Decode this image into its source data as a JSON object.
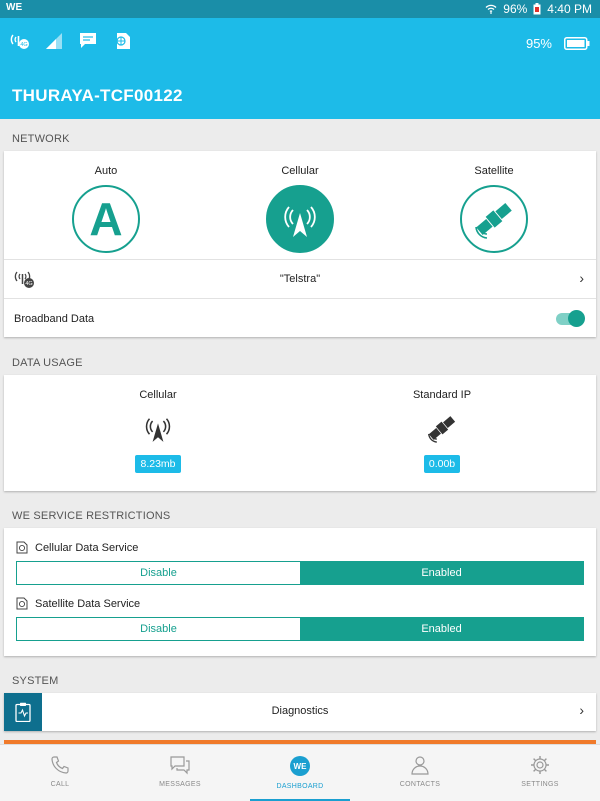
{
  "statusbar": {
    "carrier": "WE",
    "battery": "96%",
    "time": "4:40 PM"
  },
  "header": {
    "battery_pct": "95%",
    "device_name": "THURAYA-TCF00122"
  },
  "network": {
    "section_label": "NETWORK",
    "modes": [
      {
        "label": "Auto",
        "letter": "A",
        "active": false
      },
      {
        "label": "Cellular",
        "active": true
      },
      {
        "label": "Satellite",
        "active": false
      }
    ],
    "operator": "\"Telstra\"",
    "chevron": "›",
    "broadband_label": "Broadband Data",
    "broadband_on": true
  },
  "data_usage": {
    "section_label": "DATA USAGE",
    "items": [
      {
        "label": "Cellular",
        "value": "8.23mb"
      },
      {
        "label": "Standard IP",
        "value": "0.00b"
      }
    ]
  },
  "restrictions": {
    "section_label": "WE SERVICE RESTRICTIONS",
    "services": [
      {
        "label": "Cellular Data Service",
        "off": "Disable",
        "on": "Enabled"
      },
      {
        "label": "Satellite Data Service",
        "off": "Disable",
        "on": "Enabled"
      }
    ]
  },
  "system": {
    "section_label": "SYSTEM",
    "diagnostics": "Diagnostics",
    "chevron": "›"
  },
  "tabs": [
    {
      "label": "CALL",
      "icon": "phone-icon"
    },
    {
      "label": "MESSAGES",
      "icon": "messages-icon"
    },
    {
      "label": "DASHBOARD",
      "icon": "we-logo-icon",
      "active": true
    },
    {
      "label": "CONTACTS",
      "icon": "contacts-icon"
    },
    {
      "label": "SETTINGS",
      "icon": "gear-icon"
    }
  ],
  "colors": {
    "accent": "#16a08f",
    "header": "#1dbbe8",
    "status": "#1a8ea8",
    "tab_active": "#1a9fd0",
    "alert": "#f07a2a"
  }
}
